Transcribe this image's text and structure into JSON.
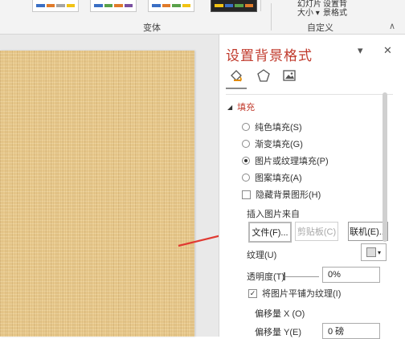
{
  "ribbon": {
    "variants_group_label": "变体",
    "customize_group_label": "自定义",
    "slide_size_line1": "幻灯片",
    "slide_size_line2": "大小",
    "format_bg_line1": "设置背",
    "format_bg_line2": "景格式",
    "thumb_colors": [
      [
        "#3a6fc4",
        "#e07b2a",
        "#a5a5a5",
        "#f2c314"
      ],
      [
        "#3a6fc4",
        "#5aa14a",
        "#e07b2a",
        "#7a4fa0"
      ],
      [
        "#3a6fc4",
        "#e07b2a",
        "#5aa14a",
        "#f2c314"
      ],
      [
        "#f2c314",
        "#3a6fc4",
        "#5aa14a",
        "#e07b2a"
      ]
    ]
  },
  "pane": {
    "title": "设置背景格式",
    "section_fill": "填充",
    "options": {
      "solid": "纯色填充(S)",
      "gradient": "渐变填充(G)",
      "picture": "图片或纹理填充(P)",
      "pattern": "图案填充(A)",
      "hide_graphics": "隐藏背景图形(H)"
    },
    "insert_picture_from": "插入图片来自",
    "buttons": {
      "file": "文件(F)...",
      "clipboard": "剪贴板(C)",
      "online": "联机(E)..."
    },
    "texture_label": "纹理(U)",
    "transparency_label": "透明度(T)",
    "transparency_value": "0%",
    "tile_label": "将图片平铺为纹理(I)",
    "offset_x_label": "偏移量 X (O)",
    "offset_y_label": "偏移量 Y(E)",
    "offset_y_value": "0 磅"
  },
  "colors": {
    "accent": "#c0392b",
    "annotation_arrow": "#e03a32",
    "slide_texture": "#e8c98c"
  }
}
